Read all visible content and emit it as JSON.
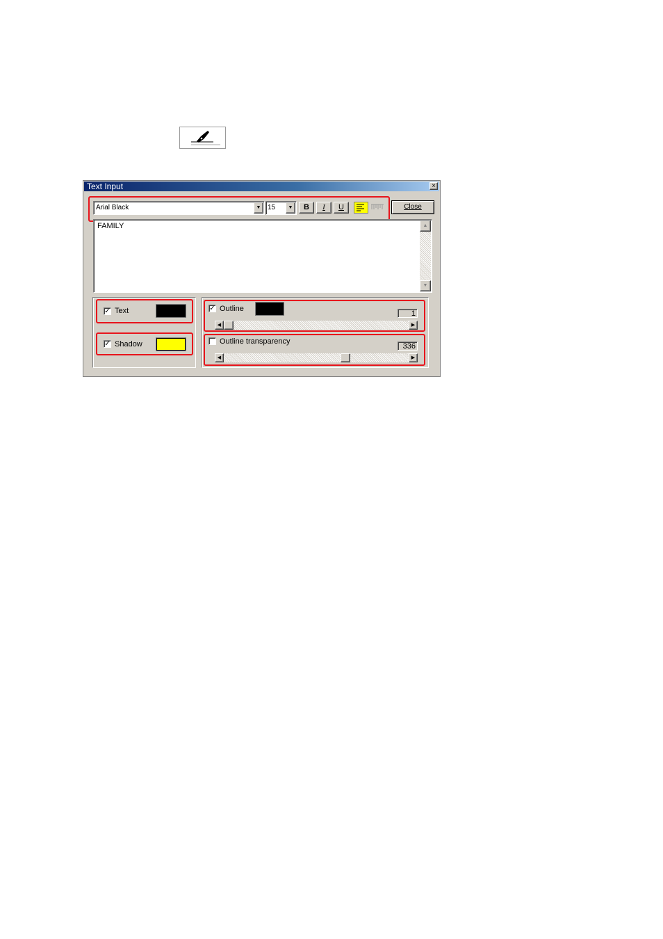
{
  "toolbar_icon": {
    "icon": "pen-nib-icon"
  },
  "window": {
    "title": "Text Input",
    "close_glyph": "×"
  },
  "font": {
    "family": "Arial Black",
    "size": "15",
    "bold_label": "B",
    "italic_label": "I",
    "underline_label": "U",
    "align_left_icon": "align-left-icon",
    "align_justify_icon": "align-justify-icon"
  },
  "close_button": {
    "label": "Close"
  },
  "text_area": {
    "value": "FAMILY"
  },
  "text_option": {
    "label": "Text",
    "checked": true,
    "color": "#000000"
  },
  "shadow_option": {
    "label": "Shadow",
    "checked": true,
    "color": "#ffff00"
  },
  "outline": {
    "label": "Outline",
    "checked": true,
    "color": "#000000",
    "value": "1"
  },
  "outline_transparency": {
    "label": "Outline transparency",
    "checked": false,
    "value": "336"
  },
  "colors": {
    "highlight": "#e8141c",
    "align_active": "#ffff00"
  }
}
